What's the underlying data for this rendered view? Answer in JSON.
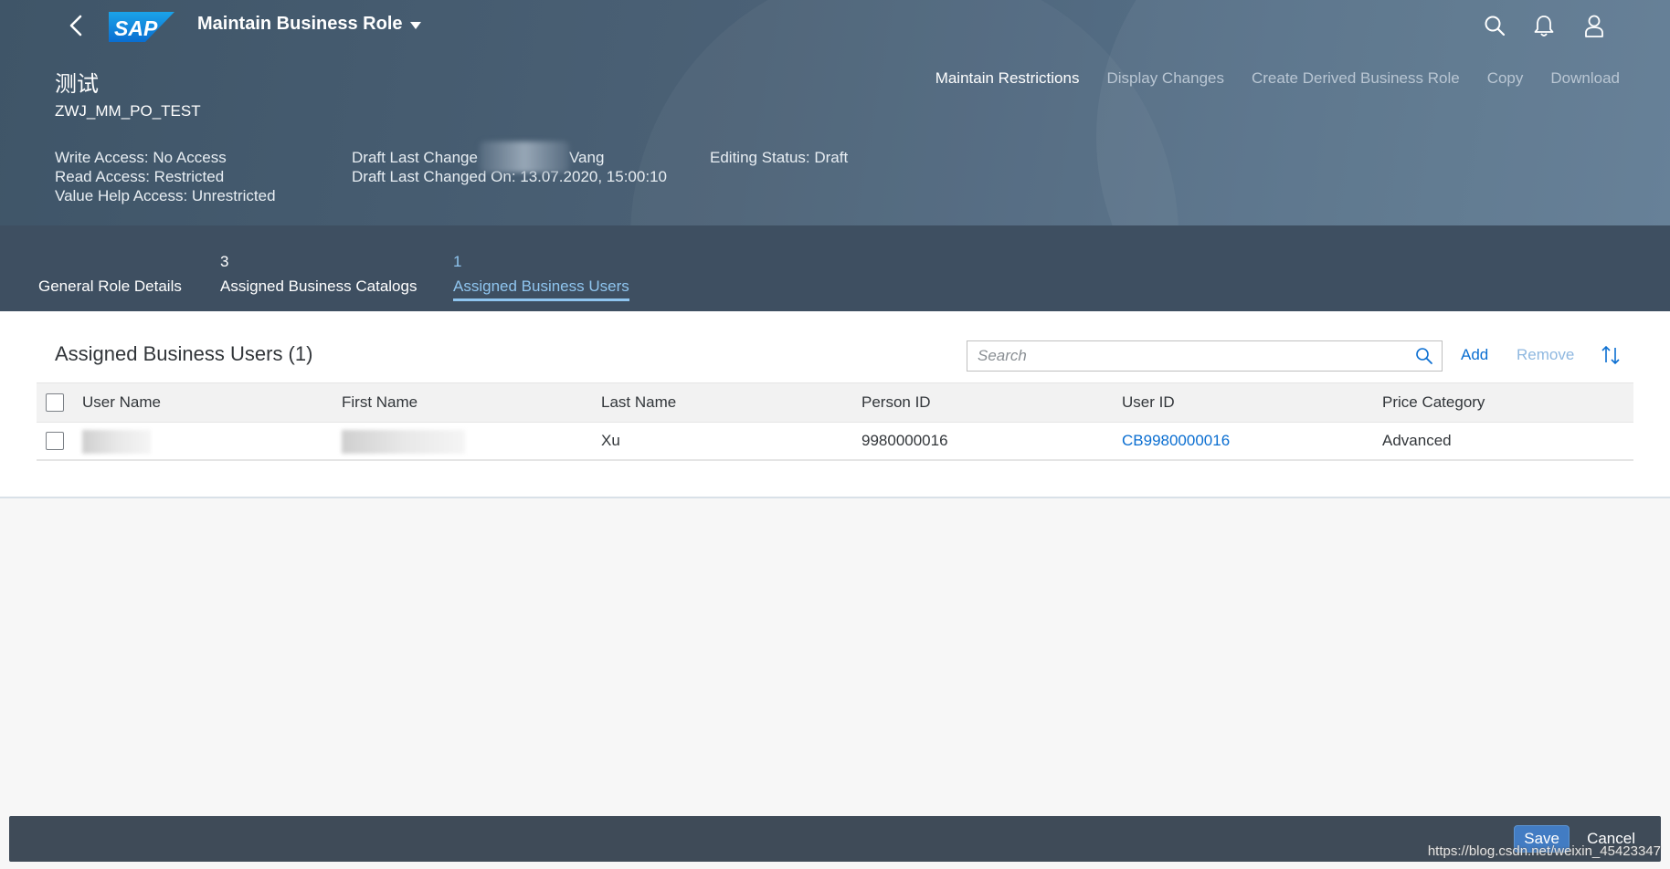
{
  "shell": {
    "back_icon": "chevron-left-icon",
    "logo_text": "SAP",
    "app_title": "Maintain Business Role",
    "icons": [
      "search-icon",
      "notification-bell-icon",
      "user-profile-icon"
    ]
  },
  "object_header": {
    "title": "测试",
    "subtitle": "ZWJ_MM_PO_TEST",
    "actions": [
      {
        "label": "Maintain Restrictions",
        "enabled": true
      },
      {
        "label": "Display Changes",
        "enabled": false
      },
      {
        "label": "Create Derived Business Role",
        "enabled": false
      },
      {
        "label": "Copy",
        "enabled": false
      },
      {
        "label": "Download",
        "enabled": false
      }
    ],
    "col1": [
      "Write Access: No Access",
      "Read Access: Restricted",
      "Value Help Access: Unrestricted"
    ],
    "col2": [
      "Draft Last Change",
      "Vang",
      "Draft Last Changed On: 13.07.2020, 15:00:10"
    ],
    "col3": [
      "Editing Status: Draft"
    ]
  },
  "tabs": [
    {
      "count": "",
      "label": "General Role Details"
    },
    {
      "count": "3",
      "label": "Assigned Business Catalogs"
    },
    {
      "count": "1",
      "label": "Assigned Business Users",
      "selected": true
    }
  ],
  "users_section": {
    "title": "Assigned Business Users (1)",
    "search_placeholder": "Search",
    "add_label": "Add",
    "remove_label": "Remove",
    "sort_icon": "sort-icon",
    "columns": [
      "User Name",
      "First Name",
      "Last Name",
      "Person ID",
      "User ID",
      "Price Category"
    ],
    "rows": [
      {
        "user_name": "",
        "first_name": "",
        "last_name": "Xu",
        "person_id": "9980000016",
        "user_id": "CB9980000016",
        "price_category": "Advanced"
      }
    ]
  },
  "footer": {
    "save_label": "Save",
    "cancel_label": "Cancel"
  },
  "watermark": "https://blog.csdn.net/weixin_45423347",
  "colors": {
    "shell": "#475b6f",
    "tabbar": "#3e4f61",
    "selected_tab": "#8fc5ef",
    "link": "#0a6ed1",
    "save_button": "#427cc3"
  }
}
